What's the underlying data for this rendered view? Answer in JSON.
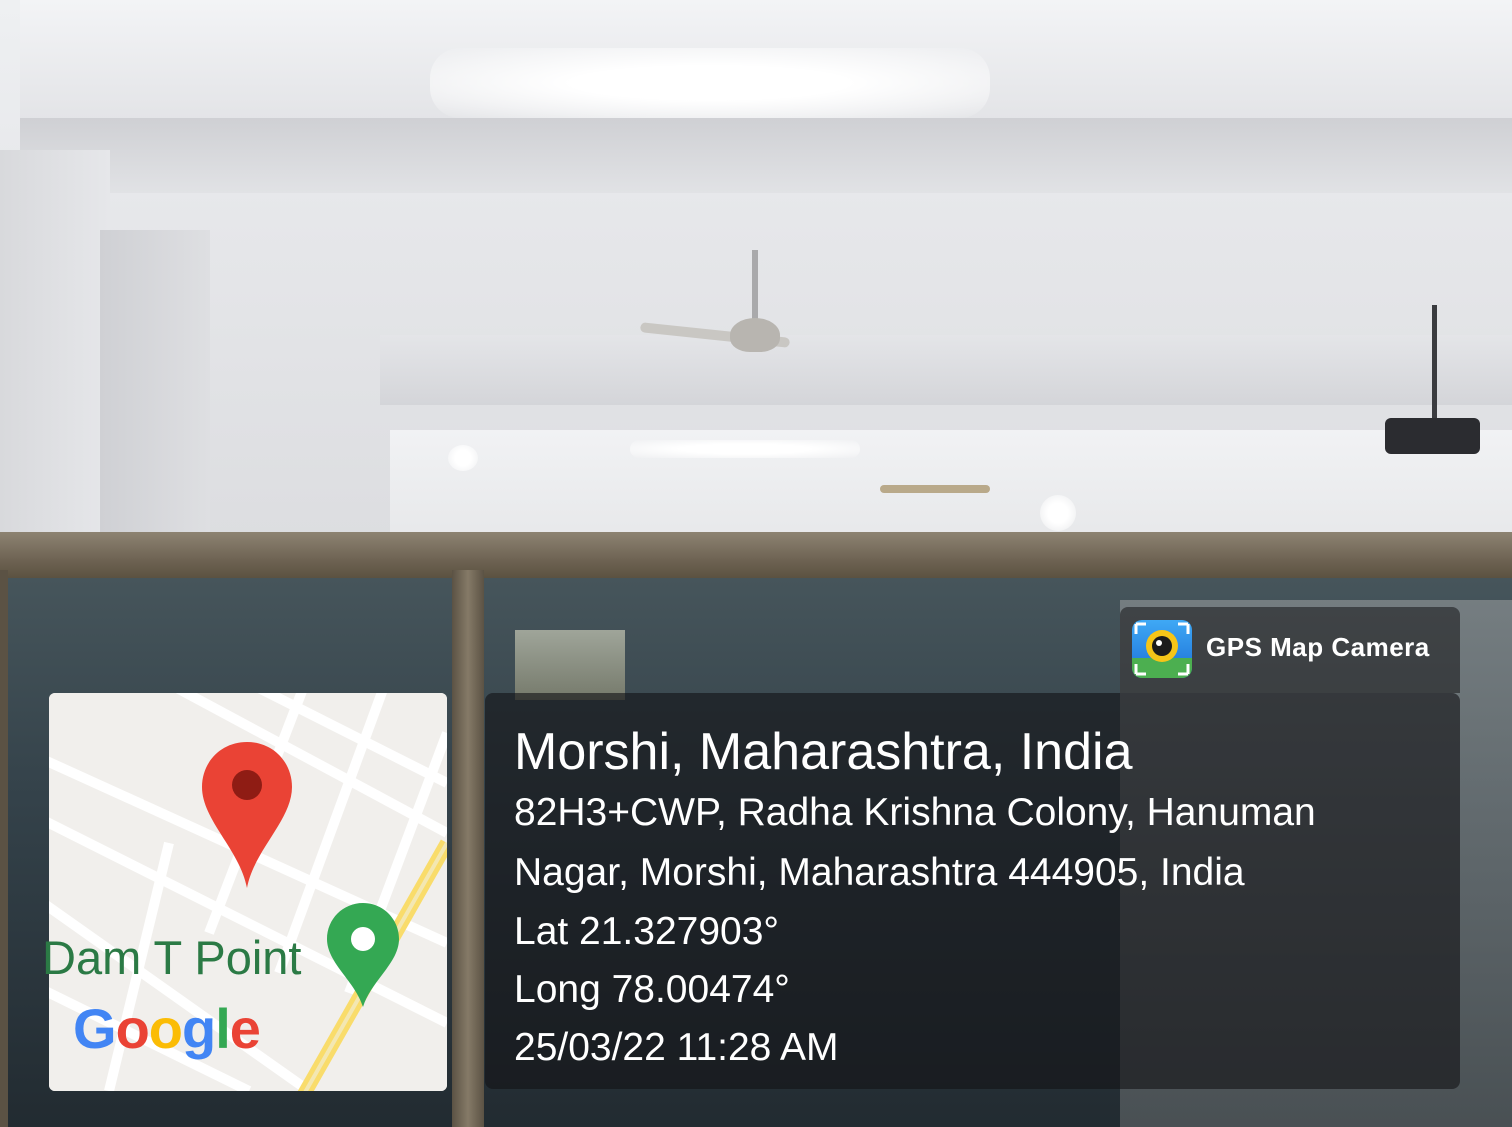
{
  "brand": {
    "label": "GPS Map Camera",
    "icon": "camera-lens-icon"
  },
  "map": {
    "place_label": "Dam T Point",
    "logo_text": "Google",
    "pin_icon": "location-pin-icon",
    "place_icon": "place-marker-icon",
    "colors": {
      "pin": "#ea4335",
      "place": "#34a853",
      "road": "#ffffff",
      "highway": "#f9dc6b"
    }
  },
  "location": {
    "city": "Morshi, Maharashtra, India",
    "address_line1": "82H3+CWP, Radha Krishna Colony, Hanuman",
    "address_line2": "Nagar, Morshi, Maharashtra 444905, India",
    "latitude": "Lat 21.327903°",
    "longitude": "Long 78.00474°",
    "datetime": "25/03/22 11:28 AM"
  }
}
